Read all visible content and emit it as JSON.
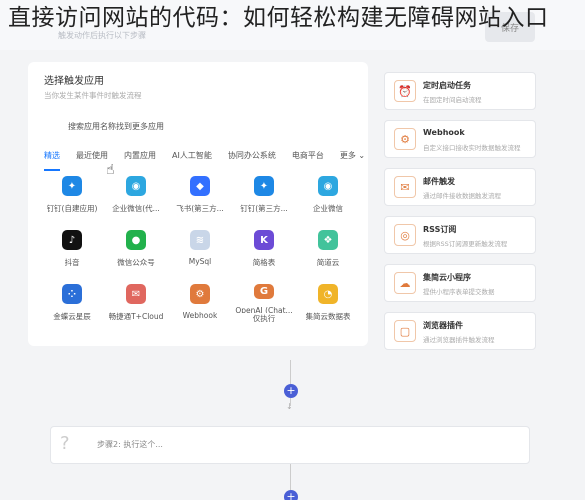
{
  "overlay_title": "直接访问网站的代码：如何轻松构建无障碍网站入口",
  "topbar": {
    "hint": "触发动作后执行以下步骤",
    "button": "保存"
  },
  "panel": {
    "title": "选择触发应用",
    "subtitle": "当你发生某件事件时触发流程",
    "search_label": "搜索应用名称找到更多应用",
    "tabs": [
      "精选",
      "最近使用",
      "内置应用",
      "AI人工智能",
      "协同办公系统",
      "电商平台",
      "更多 ⌄"
    ],
    "apps": [
      {
        "label": "钉钉(自建应用)",
        "icon": "dingtalk-icon",
        "color": "#1e88e5",
        "glyph": "✦"
      },
      {
        "label": "企业微信(代...",
        "icon": "wecom-icon",
        "color": "#2da7e0",
        "glyph": "◉"
      },
      {
        "label": "飞书(第三方...",
        "icon": "feishu-icon",
        "color": "#3370ff",
        "glyph": "◆"
      },
      {
        "label": "钉钉(第三方...",
        "icon": "dingtalk-third-icon",
        "color": "#1e88e5",
        "glyph": "✦"
      },
      {
        "label": "企业微信",
        "icon": "wecom-chat-icon",
        "color": "#2da7e0",
        "glyph": "◉"
      },
      {
        "label": "抖音",
        "icon": "douyin-icon",
        "color": "#111111",
        "glyph": "♪"
      },
      {
        "label": "微信公众号",
        "icon": "wechat-icon",
        "color": "#22b14c",
        "glyph": "●"
      },
      {
        "label": "MySql",
        "icon": "mysql-icon",
        "color": "#c9d6e8",
        "glyph": "≋"
      },
      {
        "label": "简格表",
        "icon": "jiange-icon",
        "color": "#6c4bd6",
        "glyph": "K"
      },
      {
        "label": "简道云",
        "icon": "jiandaoyun-icon",
        "color": "#42c39b",
        "glyph": "❖"
      },
      {
        "label": "金蝶云星辰",
        "icon": "kingdee-icon",
        "color": "#2b6fd8",
        "glyph": "⁘"
      },
      {
        "label": "畅捷通T+Cloud",
        "icon": "chanjet-icon",
        "color": "#e0675f",
        "glyph": "✉"
      },
      {
        "label": "Webhook",
        "icon": "webhook-icon",
        "color": "#e07a3c",
        "glyph": "⚙"
      },
      {
        "label": "OpenAI (Chat...",
        "icon": "openai-icon",
        "color": "#e07a3c",
        "glyph": "G"
      },
      {
        "label": "集简云数据表",
        "icon": "jijianyun-table-icon",
        "color": "#f0b429",
        "glyph": "◔"
      }
    ],
    "app_extra_label": "仅执行"
  },
  "cards": [
    {
      "title": "定时启动任务",
      "desc": "在固定时间启动流程",
      "icon": "alarm-clock-icon",
      "glyph": "⏰"
    },
    {
      "title": "Webhook",
      "desc": "自定义接口接收实时数据触发流程",
      "icon": "webhook-icon",
      "glyph": "⚙"
    },
    {
      "title": "邮件触发",
      "desc": "通过邮件接收数据触发流程",
      "icon": "mail-icon",
      "glyph": "✉"
    },
    {
      "title": "RSS订阅",
      "desc": "根据RSS订阅源更新触发流程",
      "icon": "rss-icon",
      "glyph": "◎"
    },
    {
      "title": "集简云小程序",
      "desc": "提供小程序表单提交数据",
      "icon": "miniprogram-icon",
      "glyph": "☁"
    },
    {
      "title": "浏览器插件",
      "desc": "通过浏览器插件触发流程",
      "icon": "browser-plugin-icon",
      "glyph": "▢"
    }
  ],
  "step": {
    "text": "步骤2: 执行这个...",
    "icon": "question-icon"
  },
  "plus_glyph": "+"
}
